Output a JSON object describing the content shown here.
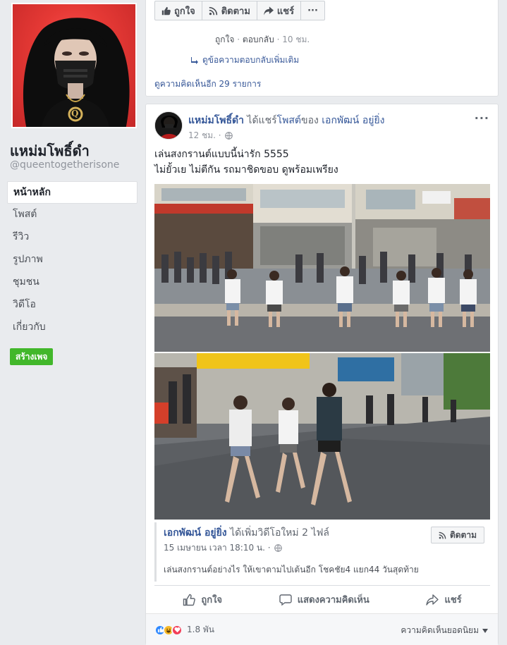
{
  "page": {
    "name": "แหม่มโพธิ์ดำ",
    "handle": "@queentogetherisone",
    "profile_badge": "Q"
  },
  "nav": {
    "items": [
      {
        "label": "หน้าหลัก",
        "active": true
      },
      {
        "label": "โพสต์"
      },
      {
        "label": "รีวิว"
      },
      {
        "label": "รูปภาพ"
      },
      {
        "label": "ชุมชน"
      },
      {
        "label": "วิดีโอ"
      },
      {
        "label": "เกี่ยวกับ"
      }
    ],
    "create_page": "สร้างเพจ"
  },
  "top_card": {
    "like": "ถูกใจ",
    "follow": "ติดตาม",
    "share": "แชร์",
    "more": "···",
    "reply_like": "ถูกใจ",
    "reply_reply": "ตอบกลับ",
    "sep": "·",
    "reply_time": "10 ชม.",
    "view_more_replies": "ดูข้อความตอบกลับเพิ่มเติม",
    "view_more_comments": "ดูความคิดเห็นอีก 29 รายการ"
  },
  "post": {
    "author": "แหม่มโพธิ์ดำ",
    "action_text": " ได้แชร์",
    "link_text": "โพสต์",
    "of_text": "ของ ",
    "original_author": "เอกพัฒน์ อยู่ยิ่ง",
    "time": "12 ชม. ·",
    "menu": "···",
    "text_line1": "เล่นสงกรานต์แบบนี้น่ารัก 5555",
    "text_line2": "ไม่ยั้วเย ไม่ตีกัน รถมาชิดขอบ ดูพร้อมเพรียง",
    "shared": {
      "author": "เอกพัฒน์ อยู่ยิ่ง",
      "action": " ได้เพิ่มวิดีโอใหม่ 2 ไฟล์",
      "time": "15 เมษายน เวลา 18:10 น. ·",
      "follow": "ติดตาม",
      "caption": "เล่นสงกรานต์อย่างไร ให้เขาตามไปเต้นอีก โชคชัย4 แยก44 วันสุดท้าย"
    },
    "actions": {
      "like": "ถูกใจ",
      "comment": "แสดงความคิดเห็น",
      "share": "แชร์"
    },
    "reaction_count": "1.8 พัน",
    "sort_label": "ความคิดเห็นยอดนิยม"
  },
  "colors": {
    "link": "#365899",
    "create_page_bg": "#42b72a",
    "background": "#e9ebee",
    "like_blue": "#2d88ff",
    "haha_yellow": "#f7b928",
    "love_red": "#f33e58"
  }
}
